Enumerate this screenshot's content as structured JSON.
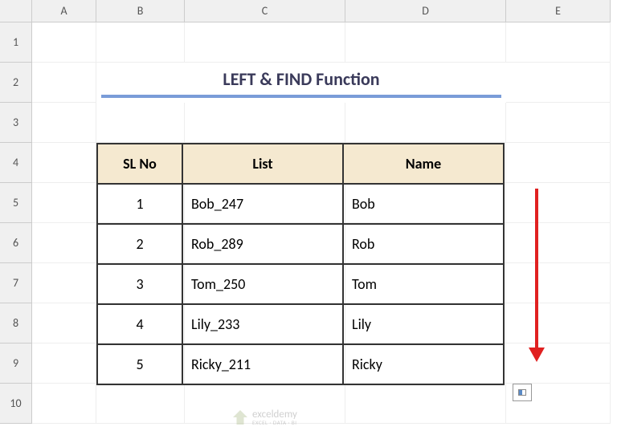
{
  "columns": [
    "",
    "A",
    "B",
    "C",
    "D",
    "E"
  ],
  "rows": [
    "1",
    "2",
    "3",
    "4",
    "5",
    "6",
    "7",
    "8",
    "9",
    "10"
  ],
  "title": "LEFT & FIND Function",
  "table": {
    "headers": {
      "sl": "SL No",
      "list": "List",
      "name": "Name"
    },
    "rows": [
      {
        "sl": "1",
        "list": "Bob_247",
        "name": "Bob"
      },
      {
        "sl": "2",
        "list": "Rob_289",
        "name": "Rob"
      },
      {
        "sl": "3",
        "list": "Tom_250",
        "name": "Tom"
      },
      {
        "sl": "4",
        "list": "Lily_233",
        "name": "Lily"
      },
      {
        "sl": "5",
        "list": "Ricky_211",
        "name": "Ricky"
      }
    ]
  },
  "watermark": {
    "brand": "exceldemy",
    "tagline": "EXCEL · DATA · BI"
  },
  "chart_data": {
    "type": "table",
    "title": "LEFT & FIND Function",
    "columns": [
      "SL No",
      "List",
      "Name"
    ],
    "rows": [
      [
        1,
        "Bob_247",
        "Bob"
      ],
      [
        2,
        "Rob_289",
        "Rob"
      ],
      [
        3,
        "Tom_250",
        "Tom"
      ],
      [
        4,
        "Lily_233",
        "Lily"
      ],
      [
        5,
        "Ricky_211",
        "Ricky"
      ]
    ]
  }
}
